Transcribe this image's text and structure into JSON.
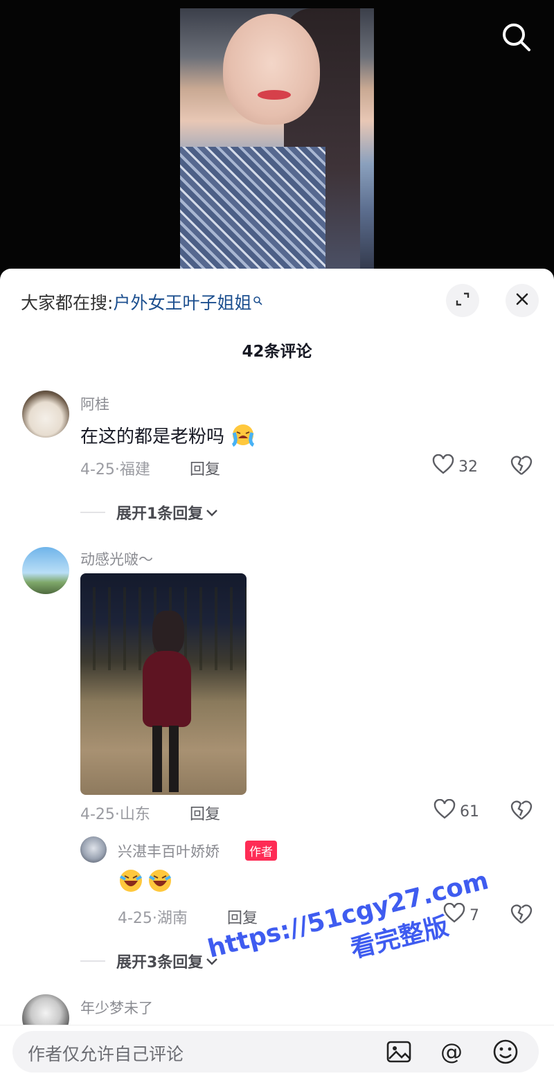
{
  "hot_search": {
    "prefix": "大家都在搜:",
    "query": "户外女王叶子姐姐"
  },
  "comment_count": "42条评论",
  "comments": [
    {
      "user": "阿桂",
      "text": "在这的都是老粉吗",
      "meta": "4-25·福建",
      "reply": "回复",
      "likes": "32",
      "expand": "展开1条回复"
    },
    {
      "user": "动感光啵～",
      "meta": "4-25·山东",
      "reply": "回复",
      "likes": "61",
      "sub": {
        "user": "兴湛丰百叶娇娇",
        "badge": "作者",
        "meta": "4-25·湖南",
        "reply": "回复",
        "likes": "7"
      },
      "expand": "展开3条回复"
    },
    {
      "user": "年少梦未了"
    }
  ],
  "input": {
    "placeholder": "作者仅允许自己评论"
  },
  "watermark": {
    "line1": "https://51cgy27.com",
    "line2": "看完整版"
  },
  "colors": {
    "accent_red": "#fe2c55",
    "link_blue": "#1c4f8f",
    "emoji_yellow": "#ffc83d"
  },
  "icons": [
    "search-icon",
    "expand-icon",
    "close-icon",
    "heart-icon",
    "broken-heart-icon",
    "chevron-down-icon",
    "image-icon",
    "at-icon",
    "emoji-icon"
  ]
}
